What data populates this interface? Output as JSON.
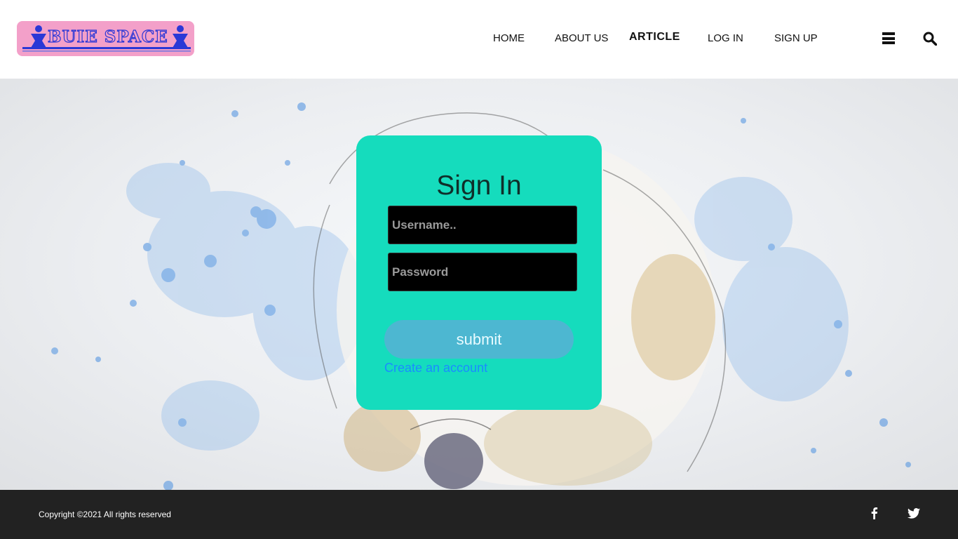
{
  "header": {
    "logo_text": "BUIE SPACE",
    "nav": {
      "home": "HOME",
      "about": "ABOUT US",
      "article": "ARTICLE",
      "login": "LOG IN",
      "signup": "SIGN UP"
    },
    "icons": {
      "menu": "hamburger-menu-icon",
      "search": "search-icon"
    }
  },
  "signin": {
    "title": "Sign In",
    "username_placeholder": "Username..",
    "password_placeholder": "Password",
    "submit_label": "submit",
    "create_account": "Create an account"
  },
  "footer": {
    "copyright": "Copyright ©2021 All rights reserved",
    "icons": [
      "facebook-icon",
      "twitter-icon"
    ]
  },
  "colors": {
    "card": "#15dcbd",
    "submit": "#4db7d1",
    "link": "#1a8cff",
    "footer": "#222222",
    "logo_bg": "#f3a0c9",
    "logo_ink": "#2b38d6"
  }
}
